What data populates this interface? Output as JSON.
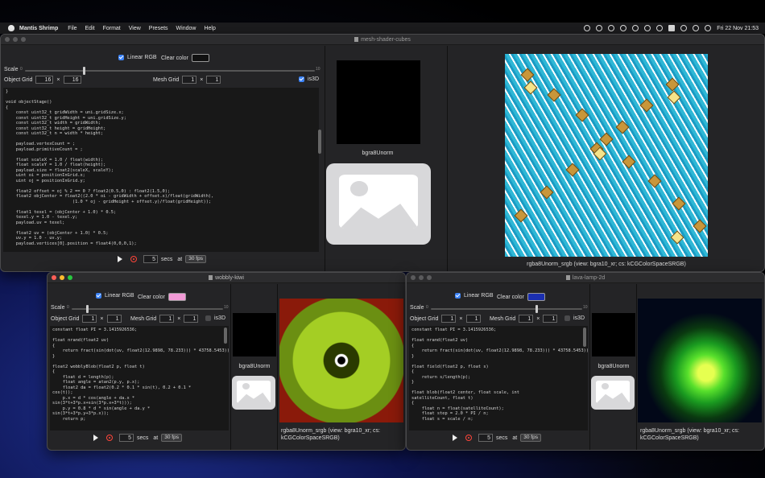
{
  "menubar": {
    "app": "Mantis Shrimp",
    "items": [
      "File",
      "Edit",
      "Format",
      "View",
      "Presets",
      "Window",
      "Help"
    ],
    "clock": "Fri 22 Nov  21:53"
  },
  "main": {
    "title": "mesh-shader-cubes",
    "linear_rgb": "Linear RGB",
    "clear_color": "Clear color",
    "scale": "Scale",
    "tick_min": "0",
    "tick_max": "10",
    "object_grid": "Object Grid",
    "og_x": "16",
    "og_y": "16",
    "times": "×",
    "mesh_grid": "Mesh Grid",
    "mg_x": "1",
    "mg_y": "1",
    "is3d": "is3D",
    "secs_value": "5",
    "secs": "secs",
    "at": "at",
    "fps": "30 fps",
    "thumb_label": "bgra8Unorm",
    "preview_label": "rgba8Unorm_srgb (view: bgra10_xr; cs: kCGColorSpaceSRGB)",
    "clear_swatch": "#111111"
  },
  "kiwi": {
    "title": "wobbly-kiwi",
    "linear_rgb": "Linear RGB",
    "clear_color": "Clear color",
    "scale": "Scale",
    "tick_min": "0",
    "tick_max": "10",
    "object_grid": "Object Grid",
    "og_x": "1",
    "og_y": "1",
    "times": "×",
    "mesh_grid": "Mesh Grid",
    "mg_x": "1",
    "mg_y": "1",
    "is3d": "is3D",
    "secs_value": "5",
    "secs": "secs",
    "at": "at",
    "fps": "30 fps",
    "thumb_label": "bgra8Unorm",
    "preview_label": "rgba8Unorm_srgb (view: bgra10_xr; cs: kCGColorSpaceSRGB)",
    "clear_swatch": "#f29ad6"
  },
  "lava": {
    "title": "lava-lamp-2d",
    "linear_rgb": "Linear RGB",
    "clear_color": "Clear color",
    "scale": "Scale",
    "tick_min": "0",
    "tick_max": "10",
    "object_grid": "Object Grid",
    "og_x": "1",
    "og_y": "1",
    "times": "×",
    "mesh_grid": "Mesh Grid",
    "mg_x": "1",
    "mg_y": "1",
    "is3d": "is3D",
    "secs_value": "5",
    "secs": "secs",
    "at": "at",
    "fps": "30 fps",
    "thumb_label": "bgra8Unorm",
    "preview_label": "rgba8Unorm_srgb (view: bgra10_xr; cs: kCGColorSpaceSRGB)",
    "clear_swatch": "#1b2fb0"
  },
  "code_main": "}\n\nvoid objectStage()\n{\n    const uint32_t gridWidth = uni.gridSize.x;\n    const uint32_t gridHeight = uni.gridSize.y;\n    const uint32_t width = gridWidth;\n    const uint32_t height = gridHeight;\n    const uint32_t n = width * height;\n\n    payload.vertexCount = ;\n    payload.primitiveCount = ;\n\n    float scaleX = 1.0 / float(width);\n    float scaleY = 1.0 / float(height);\n    payload.size = float2(scaleX, scaleY);\n    uint oi = positionInGrid.x;\n    uint oj = positionInGrid.y;\n\n    float2 offset = oj % 2 == 0 ? float2(0.5,0) : float2(1.5,0);\n    float2 objCenter = float2((2.0 * oi - gridWidth + offset.x)/float(gridWidth),\n                          (1.0 * oj - gridHeight + offset.y)/float(gridHeight));\n\n    float1 texel = (objCenter + 1.0) * 0.5;\n    texel.y = 1.0 - texel.y;\n    payload.uv = texel;\n\n    float2 uv = (objCenter + 1.0) * 0.5;\n    uv.y = 1.0 - uv.y;\n    payload.vertices[0].position = float4(0,0,0,1);",
  "code_kiwi": "constant float PI = 3.1415926536;\n\nfloat nrand(float2 uv)\n{\n    return fract(sin(dot(uv, float2(12.9898, 78.233))) * 43758.5453));\n}\n\nfloat2 wobblyBlob(float2 p, float t)\n{\n    float d = length(p);\n    float angle = atan2(p.y, p.x);\n    float2 da = float2(0.2 * 0.1 * sin(t), 0.2 + 0.1 *\ncos(t));\n    p.x = d * cos(angle + da.x *\nsin(3*t+3*p.x+sin(3*p.x+3*t)));\n    p.y = 0.8 * d * sin(angle + da.y *\nsin(3*t+3*p.y+3*p.x));\n    return p;",
  "code_lava": "constant float PI = 3.1415926536;\n\nfloat nrand(float2 uv)\n{\n    return fract(sin(dot(uv, float2(12.9898, 78.233))) * 43758.5453));\n}\n\nfloat field(float2 p, float s)\n{\n    return s/length(p);\n}\n\nfloat blob(float2 center, float scale, int\nsatelliteCount, float t)\n{\n    float n = float(satelliteCount);\n    float step = 2.0 * PI / n;\n    float s = scale / n;"
}
